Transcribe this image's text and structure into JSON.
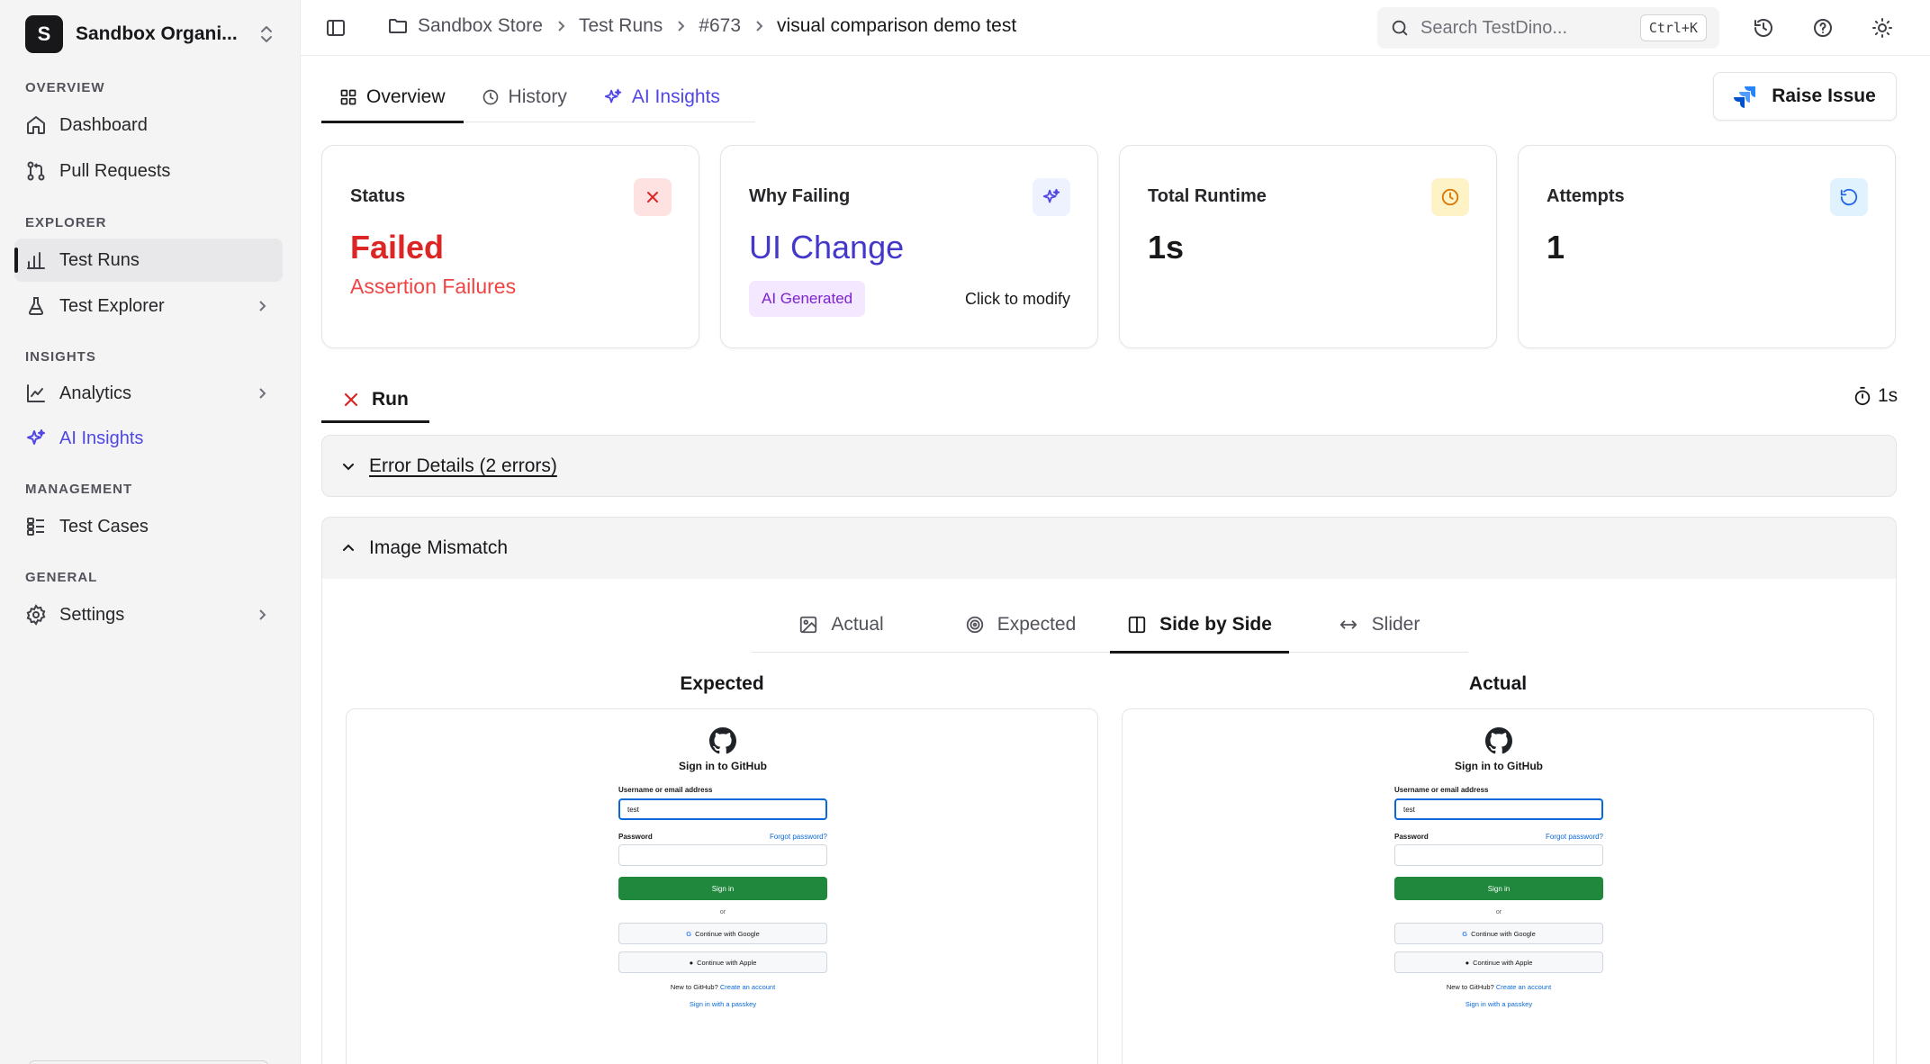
{
  "org": {
    "badge": "S",
    "name": "Sandbox Organi..."
  },
  "sidebar": {
    "sections": [
      {
        "title": "OVERVIEW"
      },
      {
        "title": "EXPLORER"
      },
      {
        "title": "INSIGHTS"
      },
      {
        "title": "MANAGEMENT"
      },
      {
        "title": "GENERAL"
      }
    ],
    "items": [
      {
        "label": "Dashboard",
        "icon": "home-icon"
      },
      {
        "label": "Pull Requests",
        "icon": "git-pull-request-icon"
      },
      {
        "label": "Test Runs",
        "icon": "bar-chart-icon"
      },
      {
        "label": "Test Explorer",
        "icon": "flask-icon"
      },
      {
        "label": "Analytics",
        "icon": "line-chart-icon"
      },
      {
        "label": "AI Insights",
        "icon": "sparkles-icon"
      },
      {
        "label": "Test Cases",
        "icon": "list-icon"
      },
      {
        "label": "Settings",
        "icon": "gear-icon"
      }
    ]
  },
  "breadcrumb": [
    "Sandbox Store",
    "Test Runs",
    "#673",
    "visual comparison demo test"
  ],
  "search": {
    "placeholder": "Search TestDino...",
    "shortcut": "Ctrl+K"
  },
  "tabs": [
    {
      "label": "Overview",
      "icon": "grid-icon"
    },
    {
      "label": "History",
      "icon": "clock-icon"
    },
    {
      "label": "AI Insights",
      "icon": "sparkles-icon"
    }
  ],
  "raise_issue": "Raise Issue",
  "cards": {
    "status": {
      "title": "Status",
      "value": "Failed",
      "sub": "Assertion Failures"
    },
    "why": {
      "title": "Why Failing",
      "value": "UI Change",
      "badge": "AI Generated",
      "action": "Click to modify"
    },
    "runtime": {
      "title": "Total Runtime",
      "value": "1s"
    },
    "attempts": {
      "title": "Attempts",
      "value": "1"
    }
  },
  "run": {
    "label": "Run",
    "duration": "1s"
  },
  "errors": {
    "title": "Error Details (2 errors)"
  },
  "mismatch": {
    "title": "Image Mismatch",
    "view_tabs": [
      "Actual",
      "Expected",
      "Side by Side",
      "Slider"
    ],
    "left_title": "Expected",
    "right_title": "Actual"
  },
  "github": {
    "title": "Sign in to GitHub",
    "username_label": "Username or email address",
    "username_value": "test",
    "password_label": "Password",
    "forgot": "Forgot password?",
    "sign_in": "Sign in",
    "or": "or",
    "google": "Continue with Google",
    "apple": "Continue with Apple",
    "new_text": "New to GitHub?",
    "create": "Create an account",
    "passkey": "Sign in with a passkey"
  },
  "colors": {
    "failed": "#dc2626",
    "ai": "#4f46e5",
    "purple": "#7e22ce",
    "github_green": "#1f883d"
  }
}
